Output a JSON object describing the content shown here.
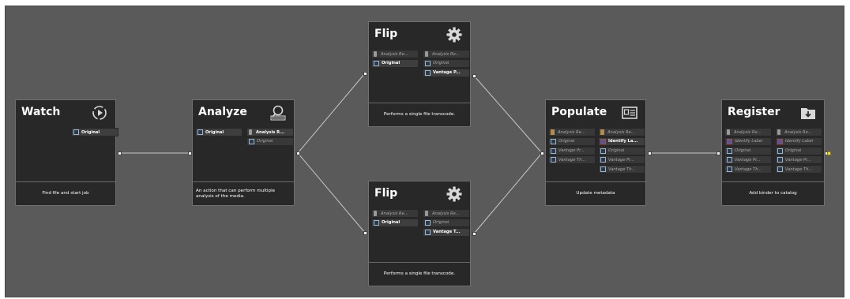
{
  "workflow": {
    "nodes": {
      "watch": {
        "title": "Watch",
        "icon": "watch-play-icon",
        "inputs": [],
        "outputs": [
          {
            "label": "Original",
            "kind": "media",
            "state": "bold"
          }
        ],
        "description": "Find file and start job"
      },
      "analyze": {
        "title": "Analyze",
        "icon": "analyze-magnifier-icon",
        "inputs": [
          {
            "label": "Original",
            "kind": "media",
            "state": "bold"
          }
        ],
        "outputs": [
          {
            "label": "Analysis R...",
            "kind": "analysis",
            "state": "bold"
          },
          {
            "label": "Original",
            "kind": "media",
            "state": "dim"
          }
        ],
        "description": "An action that can perform multiple analysis of the media."
      },
      "flip_top": {
        "title": "Flip",
        "icon": "gear-icon",
        "inputs": [
          {
            "label": "Analysis Re...",
            "kind": "analysis",
            "state": "dim"
          },
          {
            "label": "Original",
            "kind": "media",
            "state": "bold"
          }
        ],
        "outputs": [
          {
            "label": "Analysis Re...",
            "kind": "analysis",
            "state": "dim"
          },
          {
            "label": "Original",
            "kind": "media",
            "state": "dim"
          },
          {
            "label": "Vantage P...",
            "kind": "media",
            "state": "bold"
          }
        ],
        "description": "Performs a single file transcode."
      },
      "flip_bottom": {
        "title": "Flip",
        "icon": "gear-icon",
        "inputs": [
          {
            "label": "Analysis Re...",
            "kind": "analysis",
            "state": "dim"
          },
          {
            "label": "Original",
            "kind": "media",
            "state": "bold"
          }
        ],
        "outputs": [
          {
            "label": "Analysis Re...",
            "kind": "analysis",
            "state": "dim"
          },
          {
            "label": "Original",
            "kind": "media",
            "state": "dim"
          },
          {
            "label": "Vantage T...",
            "kind": "media",
            "state": "bold"
          }
        ],
        "description": "Performs a single file transcode."
      },
      "populate": {
        "title": "Populate",
        "icon": "metadata-card-icon",
        "inputs": [
          {
            "label": "Analysis Re...",
            "kind": "analysis2",
            "state": "dim"
          },
          {
            "label": "Original",
            "kind": "media",
            "state": "dim"
          },
          {
            "label": "Vantage Pr...",
            "kind": "media",
            "state": "dim"
          },
          {
            "label": "Vantage Th...",
            "kind": "media",
            "state": "dim"
          }
        ],
        "outputs": [
          {
            "label": "Analysis Re...",
            "kind": "analysis2",
            "state": "dim"
          },
          {
            "label": "Identify La...",
            "kind": "label",
            "state": "bold"
          },
          {
            "label": "Original",
            "kind": "media",
            "state": "dim"
          },
          {
            "label": "Vantage Pr...",
            "kind": "media",
            "state": "dim"
          },
          {
            "label": "Vantage Th...",
            "kind": "media",
            "state": "dim"
          }
        ],
        "description": "Update metadata"
      },
      "register": {
        "title": "Register",
        "icon": "folder-download-icon",
        "inputs": [
          {
            "label": "Analysis Re...",
            "kind": "analysis",
            "state": "dim"
          },
          {
            "label": "Identify Label",
            "kind": "label",
            "state": "dim"
          },
          {
            "label": "Original",
            "kind": "media",
            "state": "dim"
          },
          {
            "label": "Vantage Pr...",
            "kind": "media",
            "state": "dim"
          },
          {
            "label": "Vantage Th...",
            "kind": "media",
            "state": "dim"
          }
        ],
        "outputs": [
          {
            "label": "Analysis Re...",
            "kind": "analysis",
            "state": "dim"
          },
          {
            "label": "Identify Label",
            "kind": "label",
            "state": "dim"
          },
          {
            "label": "Original",
            "kind": "media",
            "state": "dim"
          },
          {
            "label": "Vantage Pr...",
            "kind": "media",
            "state": "dim"
          },
          {
            "label": "Vantage Th...",
            "kind": "media",
            "state": "dim"
          }
        ],
        "description": "Add binder to catalog"
      }
    },
    "connections": [
      [
        "watch",
        "analyze"
      ],
      [
        "analyze",
        "flip_top"
      ],
      [
        "analyze",
        "flip_bottom"
      ],
      [
        "flip_top",
        "populate"
      ],
      [
        "flip_bottom",
        "populate"
      ],
      [
        "populate",
        "register"
      ]
    ],
    "colors": {
      "canvas": "#5a5a5a",
      "node": "#282828",
      "wire": "#c8c8c8",
      "port": "#f0f0f0",
      "active_port": "#f5dc2a"
    }
  }
}
